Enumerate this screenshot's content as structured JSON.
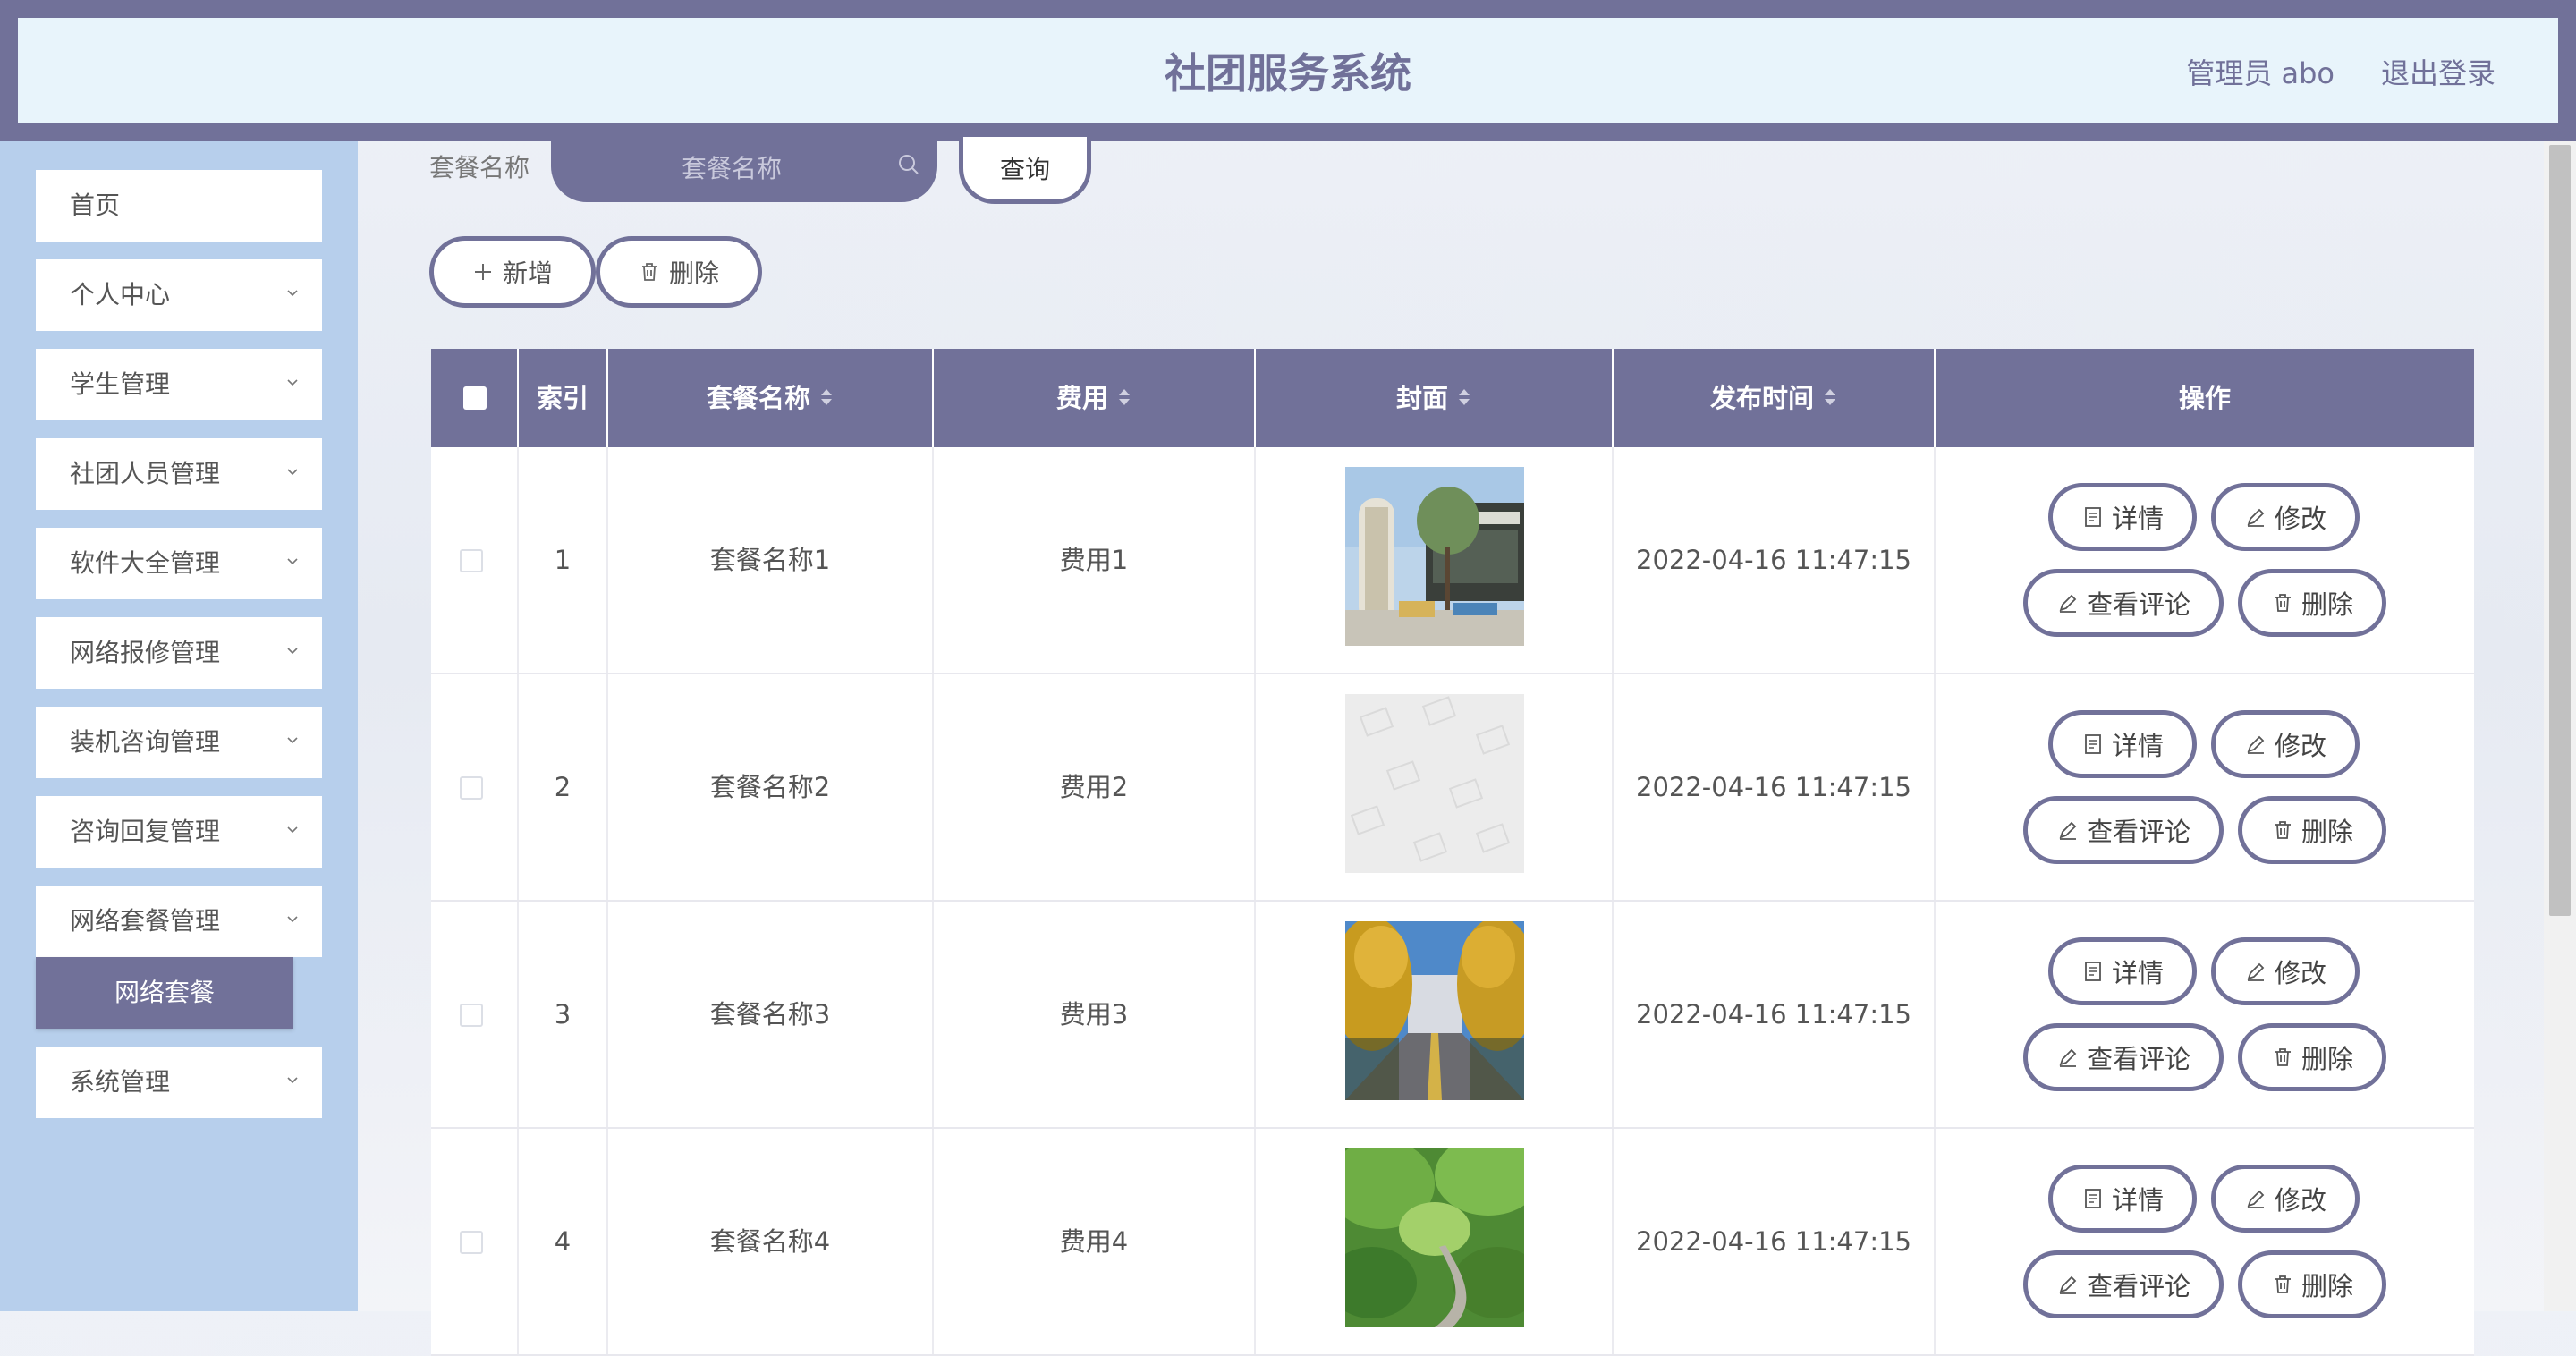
{
  "header": {
    "title": "社团服务系统",
    "user": "管理员 abo",
    "logout": "退出登录"
  },
  "sidebar": {
    "items": [
      {
        "label": "首页",
        "has_children": false
      },
      {
        "label": "个人中心",
        "has_children": true
      },
      {
        "label": "学生管理",
        "has_children": true
      },
      {
        "label": "社团人员管理",
        "has_children": true
      },
      {
        "label": "软件大全管理",
        "has_children": true
      },
      {
        "label": "网络报修管理",
        "has_children": true
      },
      {
        "label": "装机咨询管理",
        "has_children": true
      },
      {
        "label": "咨询回复管理",
        "has_children": true
      },
      {
        "label": "网络套餐管理",
        "has_children": true
      },
      {
        "label": "系统管理",
        "has_children": true
      }
    ],
    "active_sub": "网络套餐"
  },
  "search": {
    "label": "套餐名称",
    "placeholder": "套餐名称",
    "value": "",
    "button": "查询"
  },
  "toolbar": {
    "add": "新增",
    "delete": "删除"
  },
  "table": {
    "headers": [
      "",
      "索引",
      "套餐名称",
      "费用",
      "封面",
      "发布时间",
      "操作"
    ],
    "rows": [
      {
        "index": "1",
        "name": "套餐名称1",
        "fee": "费用1",
        "cover": "pavilion-photo",
        "time": "2022-04-16 11:47:15"
      },
      {
        "index": "2",
        "name": "套餐名称2",
        "fee": "费用2",
        "cover": "image-placeholder",
        "time": "2022-04-16 11:47:15"
      },
      {
        "index": "3",
        "name": "套餐名称3",
        "fee": "费用3",
        "cover": "ginkgo-avenue-photo",
        "time": "2022-04-16 11:47:15"
      },
      {
        "index": "4",
        "name": "套餐名称4",
        "fee": "费用4",
        "cover": "garden-path-photo",
        "time": "2022-04-16 11:47:15"
      }
    ],
    "actions": {
      "detail": "详情",
      "edit": "修改",
      "comments": "查看评论",
      "delete": "删除"
    }
  },
  "colors": {
    "primary": "#717199",
    "header_bg": "#e8f4fb",
    "sidebar_bg": "#b7cfec"
  }
}
